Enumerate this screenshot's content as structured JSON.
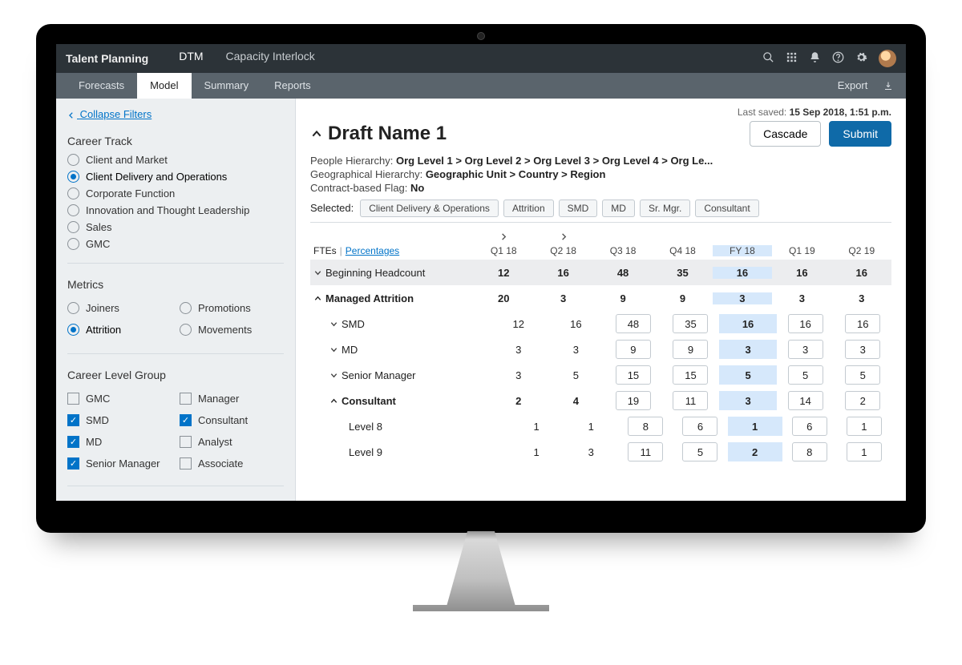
{
  "topbar": {
    "app": "Talent Planning",
    "tabs": [
      "DTM",
      "Capacity Interlock"
    ],
    "active": 0
  },
  "subtabs": {
    "items": [
      "Forecasts",
      "Model",
      "Summary",
      "Reports"
    ],
    "active": 1,
    "export": "Export"
  },
  "sidebar": {
    "collapse": "Collapse Filters",
    "careerTrack": {
      "title": "Career Track",
      "items": [
        "Client and Market",
        "Client Delivery and Operations",
        "Corporate Function",
        "Innovation and Thought Leadership",
        "Sales",
        "GMC"
      ],
      "selected": 1
    },
    "metrics": {
      "title": "Metrics",
      "items": [
        "Joiners",
        "Promotions",
        "Attrition",
        "Movements"
      ],
      "selected": 2
    },
    "clg": {
      "title": "Career Level Group",
      "items": [
        {
          "label": "GMC",
          "sel": false
        },
        {
          "label": "Manager",
          "sel": false
        },
        {
          "label": "SMD",
          "sel": true
        },
        {
          "label": "Consultant",
          "sel": true
        },
        {
          "label": "MD",
          "sel": true
        },
        {
          "label": "Analyst",
          "sel": false
        },
        {
          "label": "Senior  Manager",
          "sel": true
        },
        {
          "label": "Associate",
          "sel": false
        }
      ]
    }
  },
  "main": {
    "lastSavedLabel": "Last saved:",
    "lastSavedValue": "15 Sep 2018, 1:51 p.m.",
    "draftName": "Draft Name 1",
    "cascade": "Cascade",
    "submit": "Submit",
    "peopleLabel": "People Hierarchy:",
    "peopleValue": "Org Level 1 > Org Level 2 > Org Level 3 > Org Level 4 > Org Le...",
    "geoLabel": "Geographical Hierarchy:",
    "geoValue": "Geographic Unit > Country > Region",
    "contractLabel": "Contract-based Flag:",
    "contractValue": "No",
    "selectedLabel": "Selected:",
    "chips": [
      "Client Delivery & Operations",
      "Attrition",
      "SMD",
      "MD",
      "Sr. Mgr.",
      "Consultant"
    ],
    "toggle": {
      "a": "FTEs",
      "b": "Percentages"
    },
    "columns": [
      "Q1 18",
      "Q2 18",
      "Q3 18",
      "Q4 18",
      "FY 18",
      "Q1 19",
      "Q2 19"
    ],
    "rows": [
      {
        "label": "Beginning Headcount",
        "caret": "down",
        "hl": true,
        "indent": 0,
        "editable": [
          false,
          false,
          false,
          false,
          false,
          false,
          false
        ],
        "vals": [
          12,
          16,
          48,
          35,
          16,
          16,
          16
        ]
      },
      {
        "label": "Managed Attrition",
        "caret": "up",
        "bold": true,
        "indent": 0,
        "editable": [
          false,
          false,
          false,
          false,
          false,
          false,
          false
        ],
        "vals": [
          20,
          3,
          9,
          9,
          3,
          3,
          3
        ]
      },
      {
        "label": "SMD",
        "caret": "down",
        "indent": 1,
        "editable": [
          false,
          false,
          true,
          true,
          false,
          true,
          true
        ],
        "vals": [
          12,
          16,
          48,
          35,
          16,
          16,
          16
        ]
      },
      {
        "label": "MD",
        "caret": "down",
        "indent": 1,
        "editable": [
          false,
          false,
          true,
          true,
          false,
          true,
          true
        ],
        "vals": [
          3,
          3,
          9,
          9,
          3,
          3,
          3
        ]
      },
      {
        "label": "Senior Manager",
        "caret": "down",
        "indent": 1,
        "editable": [
          false,
          false,
          true,
          true,
          false,
          true,
          true
        ],
        "vals": [
          3,
          5,
          15,
          15,
          5,
          5,
          5
        ]
      },
      {
        "label": "Consultant",
        "caret": "up",
        "bold": true,
        "indent": 1,
        "editable": [
          false,
          false,
          true,
          true,
          false,
          true,
          true
        ],
        "vals": [
          2,
          4,
          19,
          11,
          3,
          14,
          2
        ]
      },
      {
        "label": "Level 8",
        "indent": 2,
        "editable": [
          false,
          false,
          true,
          true,
          false,
          true,
          true
        ],
        "vals": [
          1,
          1,
          8,
          6,
          1,
          6,
          1
        ]
      },
      {
        "label": "Level 9",
        "indent": 2,
        "editable": [
          false,
          false,
          true,
          true,
          false,
          true,
          true
        ],
        "vals": [
          1,
          3,
          11,
          5,
          2,
          8,
          1
        ]
      }
    ]
  }
}
